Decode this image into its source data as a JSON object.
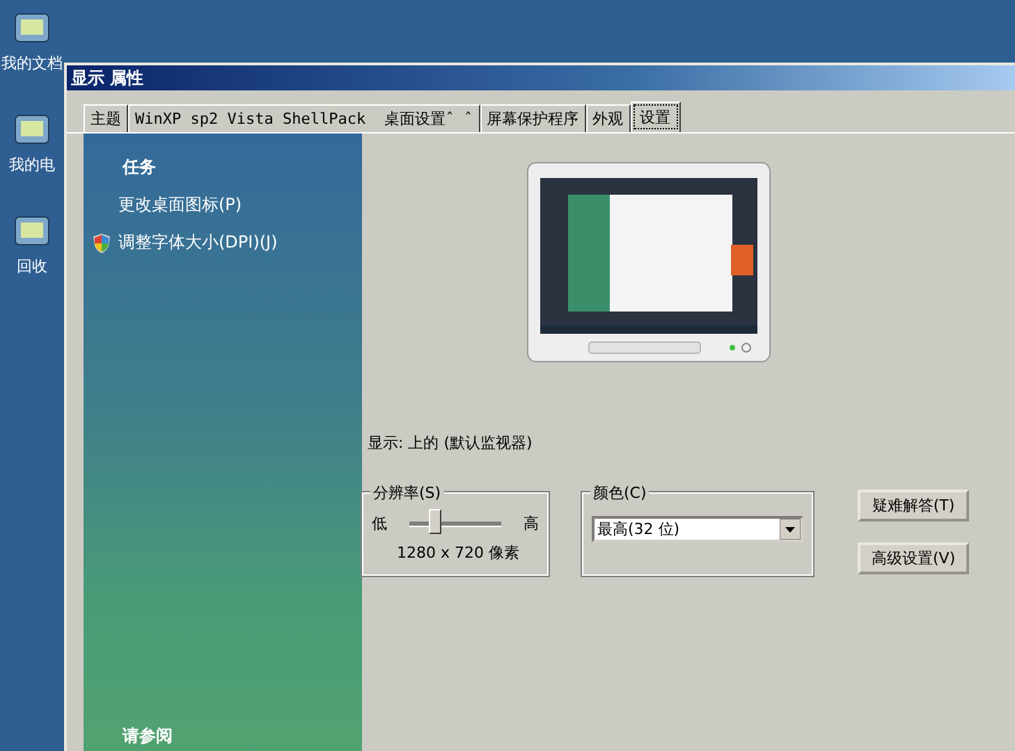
{
  "desktop_icons": [
    {
      "label": "我的文档"
    },
    {
      "label": "我的电"
    },
    {
      "label": "回收"
    }
  ],
  "window": {
    "title": "显示 属性"
  },
  "tabs": [
    {
      "label": "主题",
      "selected": false
    },
    {
      "label": "WinXP sp2 Vista ShellPack  桌面设置ˆ ˆ",
      "selected": false
    },
    {
      "label": "屏幕保护程序",
      "selected": false
    },
    {
      "label": "外观",
      "selected": false
    },
    {
      "label": "设置",
      "selected": true
    }
  ],
  "sidebar": {
    "heading": "任务",
    "items": [
      {
        "label": "更改桌面图标(P)",
        "kind": "plain"
      },
      {
        "label": "调整字体大小(DPI)(J)",
        "kind": "shield"
      }
    ],
    "footer": "请参阅"
  },
  "display_label": "显示:  上的 (默认监视器)",
  "resolution": {
    "title": "分辨率(S)",
    "low": "低",
    "high": "高",
    "level": 0.27,
    "reading": "1280 x 720 像素"
  },
  "color": {
    "title": "颜色(C)",
    "value": "最高(32 位)"
  },
  "buttons": [
    "疑难解答(T)",
    "高级设置(V)"
  ]
}
